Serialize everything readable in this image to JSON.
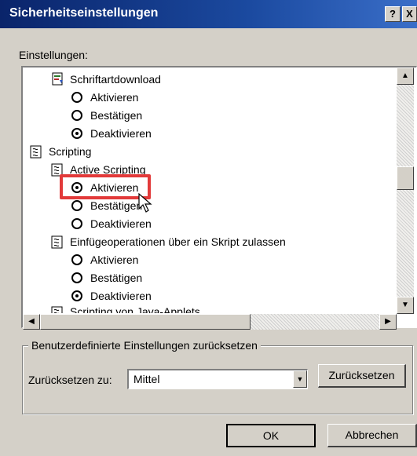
{
  "window": {
    "title": "Sicherheitseinstellungen",
    "help_label": "?",
    "close_label": "X"
  },
  "settings": {
    "label": "Einstellungen:",
    "items": [
      {
        "kind": "group",
        "label": "Schriftartdownload",
        "icon": "download-icon"
      },
      {
        "kind": "option",
        "label": "Aktivieren",
        "checked": false
      },
      {
        "kind": "option",
        "label": "Bestätigen",
        "checked": false
      },
      {
        "kind": "option",
        "label": "Deaktivieren",
        "checked": true
      },
      {
        "kind": "category",
        "label": "Scripting",
        "icon": "script-icon"
      },
      {
        "kind": "group",
        "label": "Active Scripting",
        "icon": "script-icon"
      },
      {
        "kind": "option",
        "label": "Aktivieren",
        "checked": true,
        "highlighted": true
      },
      {
        "kind": "option",
        "label": "Bestätigen",
        "checked": false
      },
      {
        "kind": "option",
        "label": "Deaktivieren",
        "checked": false
      },
      {
        "kind": "group",
        "label": "Einfügeoperationen über ein Skript zulassen",
        "icon": "script-icon"
      },
      {
        "kind": "option",
        "label": "Aktivieren",
        "checked": false
      },
      {
        "kind": "option",
        "label": "Bestätigen",
        "checked": false
      },
      {
        "kind": "option",
        "label": "Deaktivieren",
        "checked": true
      },
      {
        "kind": "group",
        "label": "Scripting von Java-Applets",
        "icon": "script-icon",
        "partial": true
      }
    ]
  },
  "reset": {
    "legend": "Benutzerdefinierte Einstellungen zurücksetzen",
    "label": "Zurücksetzen zu:",
    "value": "Mittel",
    "button": "Zurücksetzen"
  },
  "buttons": {
    "ok": "OK",
    "cancel": "Abbrechen"
  },
  "colors": {
    "titlebar": "#0a246a",
    "face": "#d4d0c8",
    "highlight": "#e23a3a"
  }
}
